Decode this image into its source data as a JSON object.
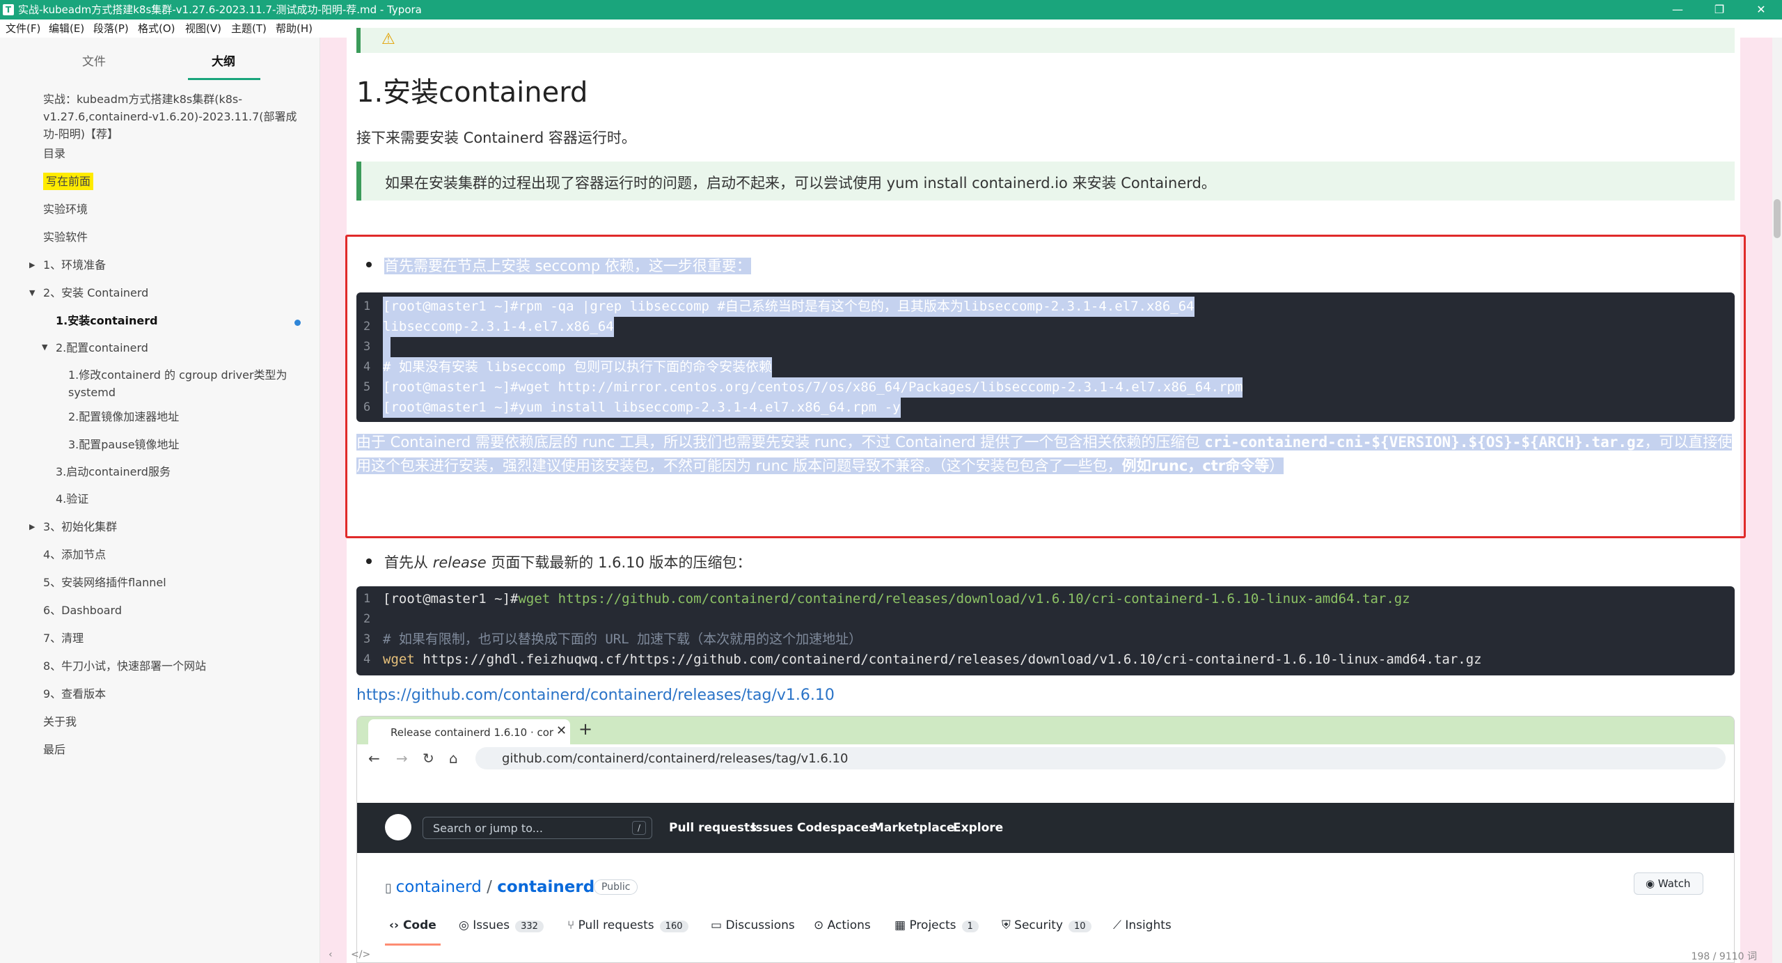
{
  "window": {
    "title": "实战-kubeadm方式搭建k8s集群-v1.27.6-2023.11.7-测试成功-阳明-荐.md - Typora",
    "app_icon": "T",
    "controls": [
      "—",
      "❐",
      "✕"
    ]
  },
  "menu": [
    "文件(F)",
    "编辑(E)",
    "段落(P)",
    "格式(O)",
    "视图(V)",
    "主题(T)",
    "帮助(H)"
  ],
  "sidebar": {
    "tabs": [
      "文件",
      "大纲"
    ],
    "active_tab": "大纲",
    "outline": [
      {
        "label": "实战：kubeadm方式搭建k8s集群(k8s-v1.27.6,containerd-v1.6.20)-2023.11.7(部署成功-阳明)【荐】"
      },
      {
        "label": "目录"
      },
      {
        "label": "写在前面"
      },
      {
        "label": "实验环境"
      },
      {
        "label": "实验软件"
      },
      {
        "label": "1、环境准备"
      },
      {
        "label": "2、安装 Containerd"
      },
      {
        "label": "1.安装containerd"
      },
      {
        "label": "2.配置containerd"
      },
      {
        "label": "1.修改containerd 的 cgroup driver类型为systemd"
      },
      {
        "label": "2.配置镜像加速器地址"
      },
      {
        "label": "3.配置pause镜像地址"
      },
      {
        "label": "3.启动containerd服务"
      },
      {
        "label": "4.验证"
      },
      {
        "label": "3、初始化集群"
      },
      {
        "label": "4、添加节点"
      },
      {
        "label": "5、安装网络插件flannel"
      },
      {
        "label": "6、Dashboard"
      },
      {
        "label": "7、清理"
      },
      {
        "label": "8、牛刀小试，快速部署一个网站"
      },
      {
        "label": "9、查看版本"
      },
      {
        "label": "关于我"
      },
      {
        "label": "最后"
      }
    ]
  },
  "content": {
    "warn_icon": "⚠",
    "heading": "1.安装containerd",
    "intro": "接下来需要安装 Containerd 容器运行时。",
    "tip": "如果在安装集群的过程出现了容器运行时的问题，启动不起来，可以尝试使用 yum install containerd.io 来安装 Containerd。",
    "bullet1": "首先需要在节点上安装 seccomp 依赖，这一步很重要：",
    "code1": [
      {
        "n": "1",
        "text": "[root@master1 ~]#rpm -qa |grep libseccomp #自己系统当时是有这个包的，且其版本为libseccomp-2.3.1-4.el7.x86_64"
      },
      {
        "n": "2",
        "text": "libseccomp-2.3.1-4.el7.x86_64"
      },
      {
        "n": "3",
        "text": " "
      },
      {
        "n": "4",
        "text": "# 如果没有安装 libseccomp 包则可以执行下面的命令安装依赖"
      },
      {
        "n": "5",
        "text": "[root@master1 ~]#wget http://mirror.centos.org/centos/7/os/x86_64/Packages/libseccomp-2.3.1-4.el7.x86_64.rpm"
      },
      {
        "n": "6",
        "text": "[root@master1 ~]#yum install libseccomp-2.3.1-4.el7.x86_64.rpm -y"
      }
    ],
    "para_a": "由于 Containerd 需要依赖底层的 runc 工具，所以我们也需要先安装 runc，不过 Containerd 提供了一个包含相关依赖的压缩包 ",
    "para_code": "cri-containerd-cni-${VERSION}.${OS}-${ARCH}.tar.gz",
    "para_b": "，可以直接使用这个包来进行安装，强烈建议使用该安装包，不然可能因为 runc 版本问题导致不兼容。（这个安装包包含了一些包，",
    "para_bold": "例如runc，ctr命令等",
    "para_c": "）",
    "bullet2_a": "首先从 ",
    "bullet2_em": "release",
    "bullet2_b": " 页面下载最新的 1.6.10 版本的压缩包：",
    "code2": {
      "l1_n": "1",
      "l1_prompt": "[root@master1 ~]#",
      "l1_cmd": "wget https://github.com/containerd/containerd/releases/download/v1.6.10/cri-containerd-1.6.10-linux-amd64.tar.gz",
      "l2_n": "2",
      "l3_n": "3",
      "l3_text": "# 如果有限制，也可以替换成下面的 URL 加速下载（本次就用的这个加速地址）",
      "l4_n": "4",
      "l4_kw": "wget",
      "l4_rest": " https://ghdl.feizhuqwq.cf/https://github.com/containerd/containerd/releases/download/v1.6.10/cri-containerd-1.6.10-linux-amd64.tar.gz"
    },
    "link": "https://github.com/containerd/containerd/releases/tag/v1.6.10"
  },
  "embedded_browser": {
    "tab_title": "Release containerd 1.6.10 · cor",
    "tab_close": "✕",
    "new_tab": "+",
    "url": "github.com/containerd/containerd/releases/tag/v1.6.10",
    "search_placeholder": "Search or jump to...",
    "slash": "/",
    "nav": [
      "Pull requests",
      "Issues",
      "Codespaces",
      "Marketplace",
      "Explore"
    ],
    "owner": "containerd",
    "repo": "containerd",
    "visibility": "Public",
    "watch": "Watch",
    "repo_tabs": [
      {
        "label": "Code",
        "count": ""
      },
      {
        "label": "Issues",
        "count": "332"
      },
      {
        "label": "Pull requests",
        "count": "160"
      },
      {
        "label": "Discussions",
        "count": ""
      },
      {
        "label": "Actions",
        "count": ""
      },
      {
        "label": "Projects",
        "count": "1"
      },
      {
        "label": "Security",
        "count": "10"
      },
      {
        "label": "Insights",
        "count": ""
      }
    ]
  },
  "status": {
    "toggle": "‹",
    "source": "</>",
    "word_count": "198 / 9110 词"
  }
}
